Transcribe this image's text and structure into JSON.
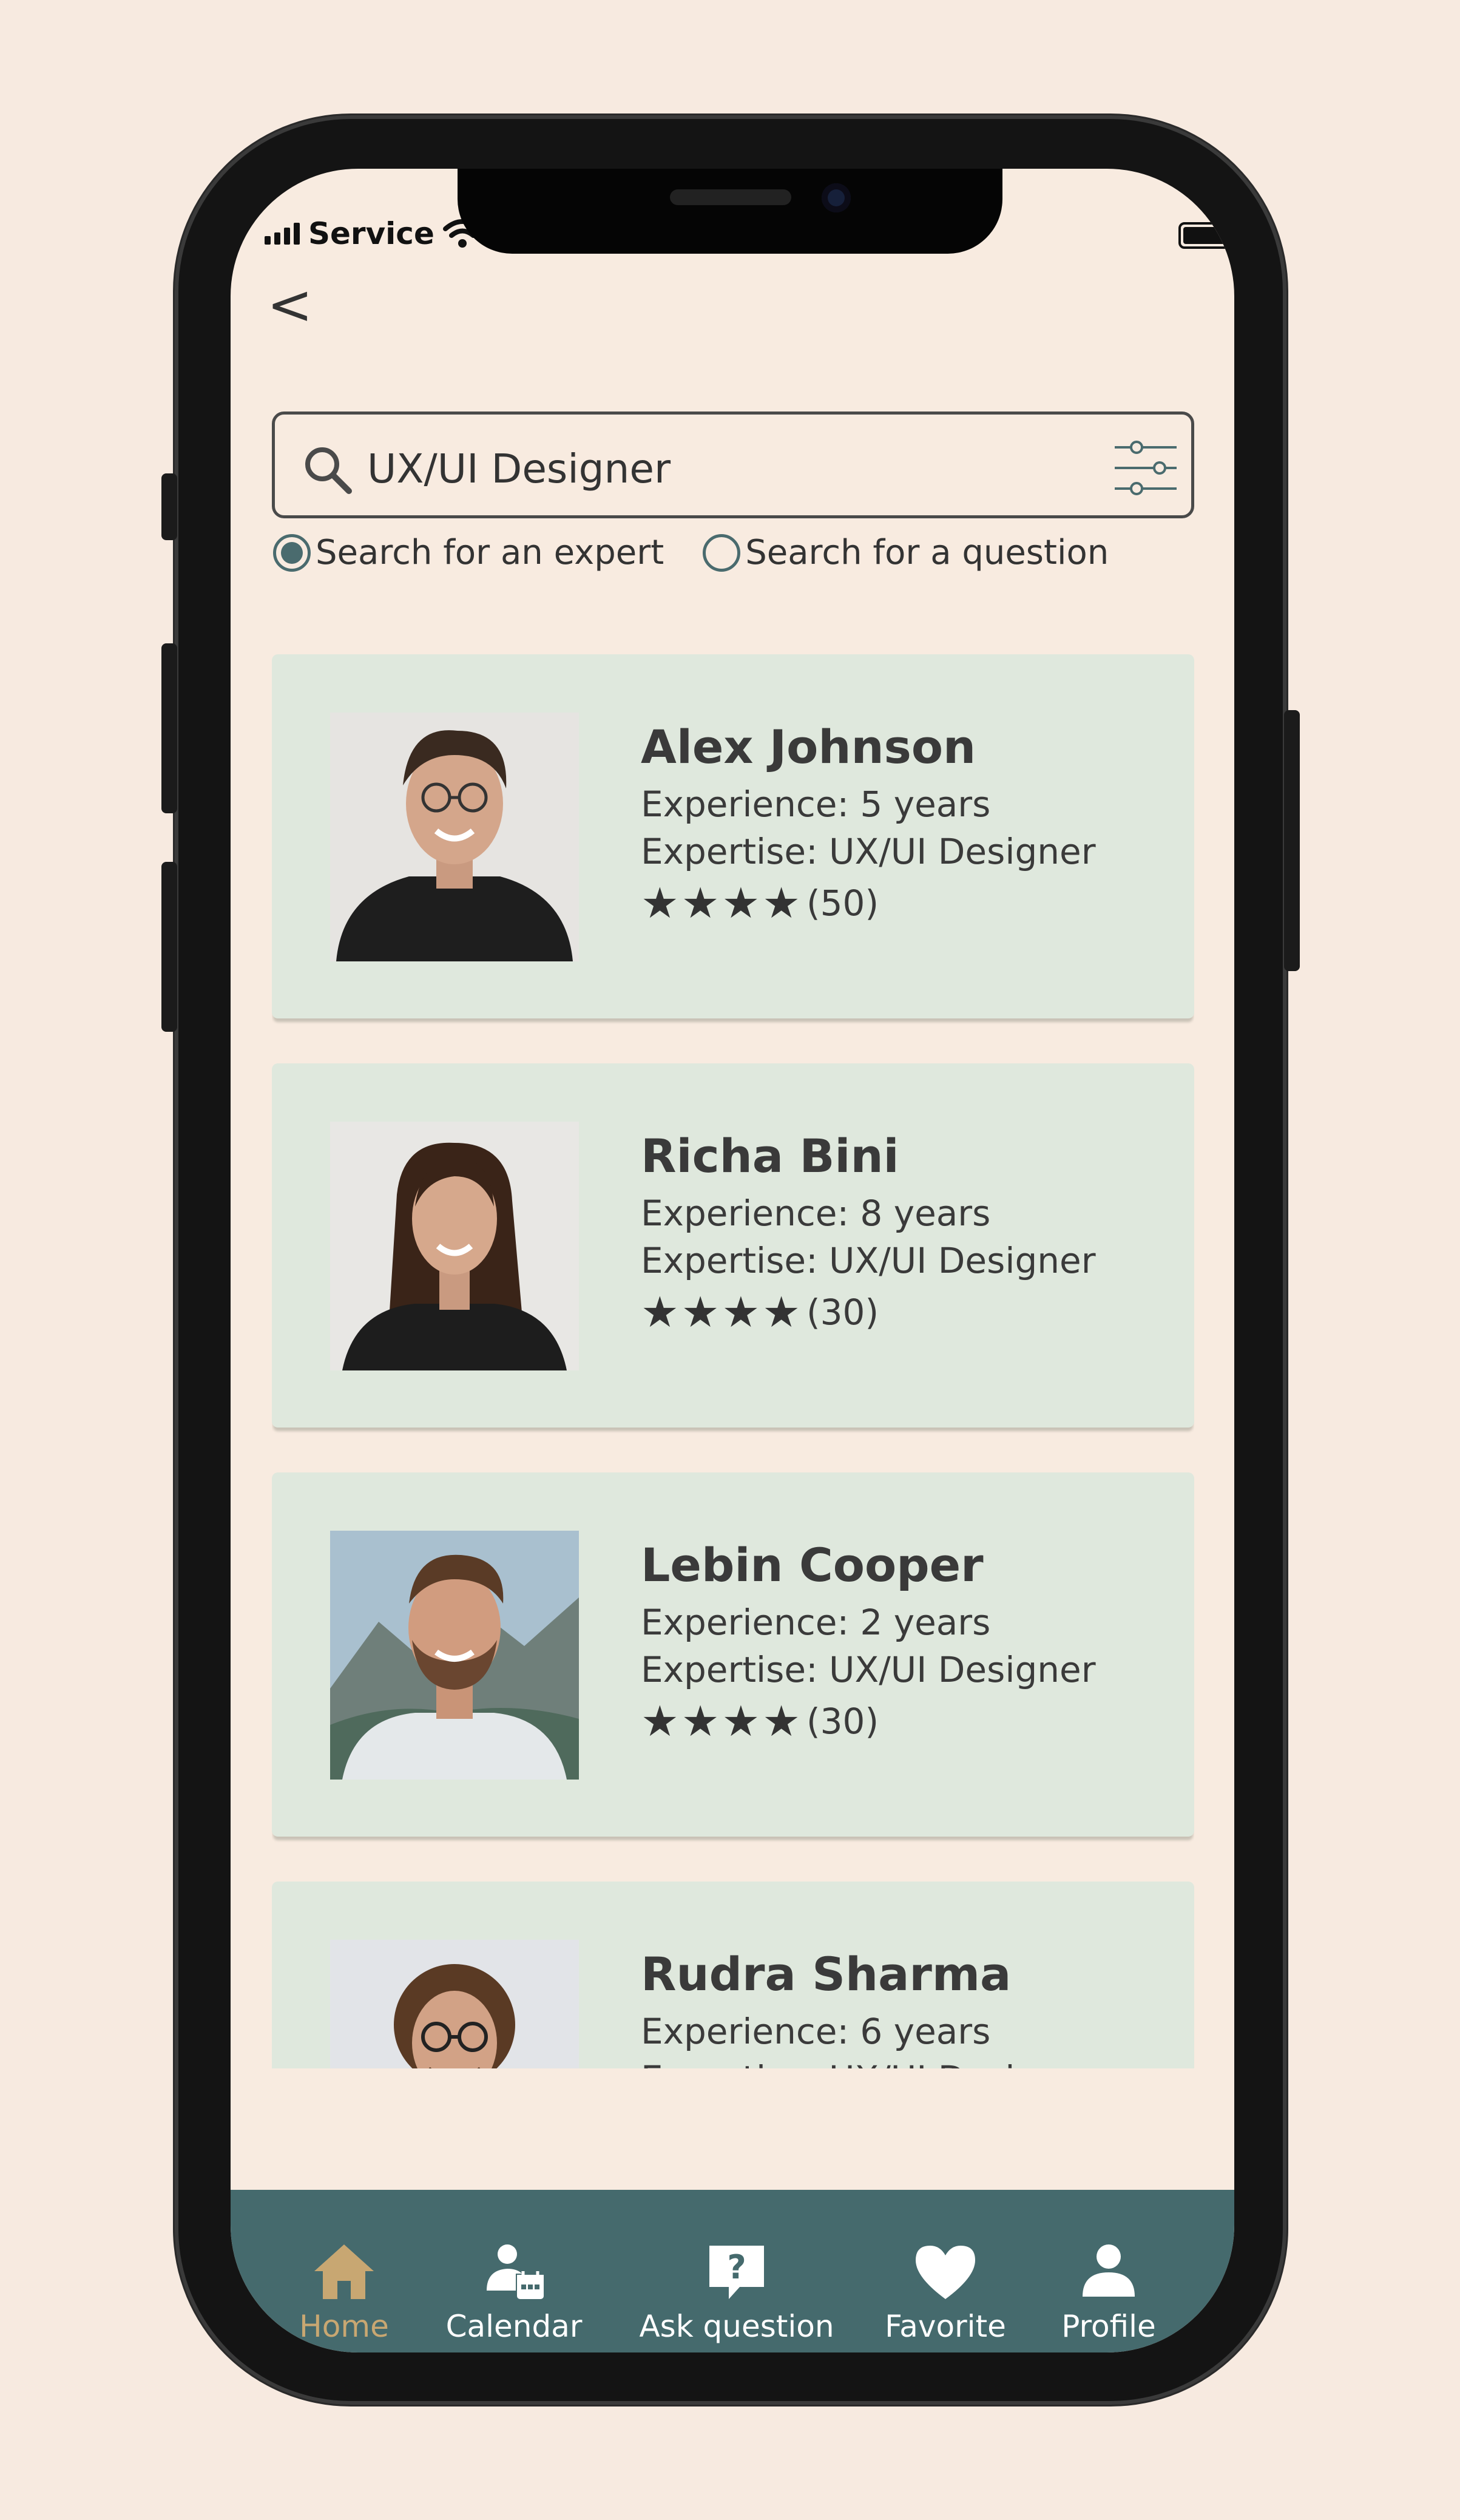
{
  "status_bar": {
    "carrier": "Service"
  },
  "search": {
    "value": "UX/UI Designer",
    "placeholder": "UX/UI Designer"
  },
  "search_mode": {
    "options": [
      {
        "label": "Search for an expert",
        "selected": true
      },
      {
        "label": "Search for a question",
        "selected": false
      }
    ]
  },
  "experts": [
    {
      "name": "Alex Johnson",
      "experience": "Experience: 5 years",
      "expertise": "Expertise: UX/UI Designer",
      "stars": "★★★★",
      "rating_count": "(50)"
    },
    {
      "name": "Richa Bini",
      "experience": "Experience: 8 years",
      "expertise": "Expertise: UX/UI Designer",
      "stars": "★★★★",
      "rating_count": "(30)"
    },
    {
      "name": "Lebin Cooper",
      "experience": "Experience: 2 years",
      "expertise": "Expertise: UX/UI Designer",
      "stars": "★★★★",
      "rating_count": "(30)"
    },
    {
      "name": "Rudra Sharma",
      "experience": "Experience: 6 years",
      "expertise": "Expertise: UX/UI Designer",
      "stars": "",
      "rating_count": ""
    }
  ],
  "tabs": [
    {
      "label": "Home",
      "icon": "home-icon",
      "active": true
    },
    {
      "label": "Calendar",
      "icon": "calendar-user-icon",
      "active": false
    },
    {
      "label": "Ask question",
      "icon": "question-bubble-icon",
      "active": false
    },
    {
      "label": "Favorite",
      "icon": "heart-icon",
      "active": false
    },
    {
      "label": "Profile",
      "icon": "person-icon",
      "active": false
    }
  ],
  "colors": {
    "background": "#f8ebe0",
    "card": "#dfe8dd",
    "tabbar": "#456a6d",
    "accent": "#4a6b6e",
    "active_tab": "#c8a772"
  }
}
